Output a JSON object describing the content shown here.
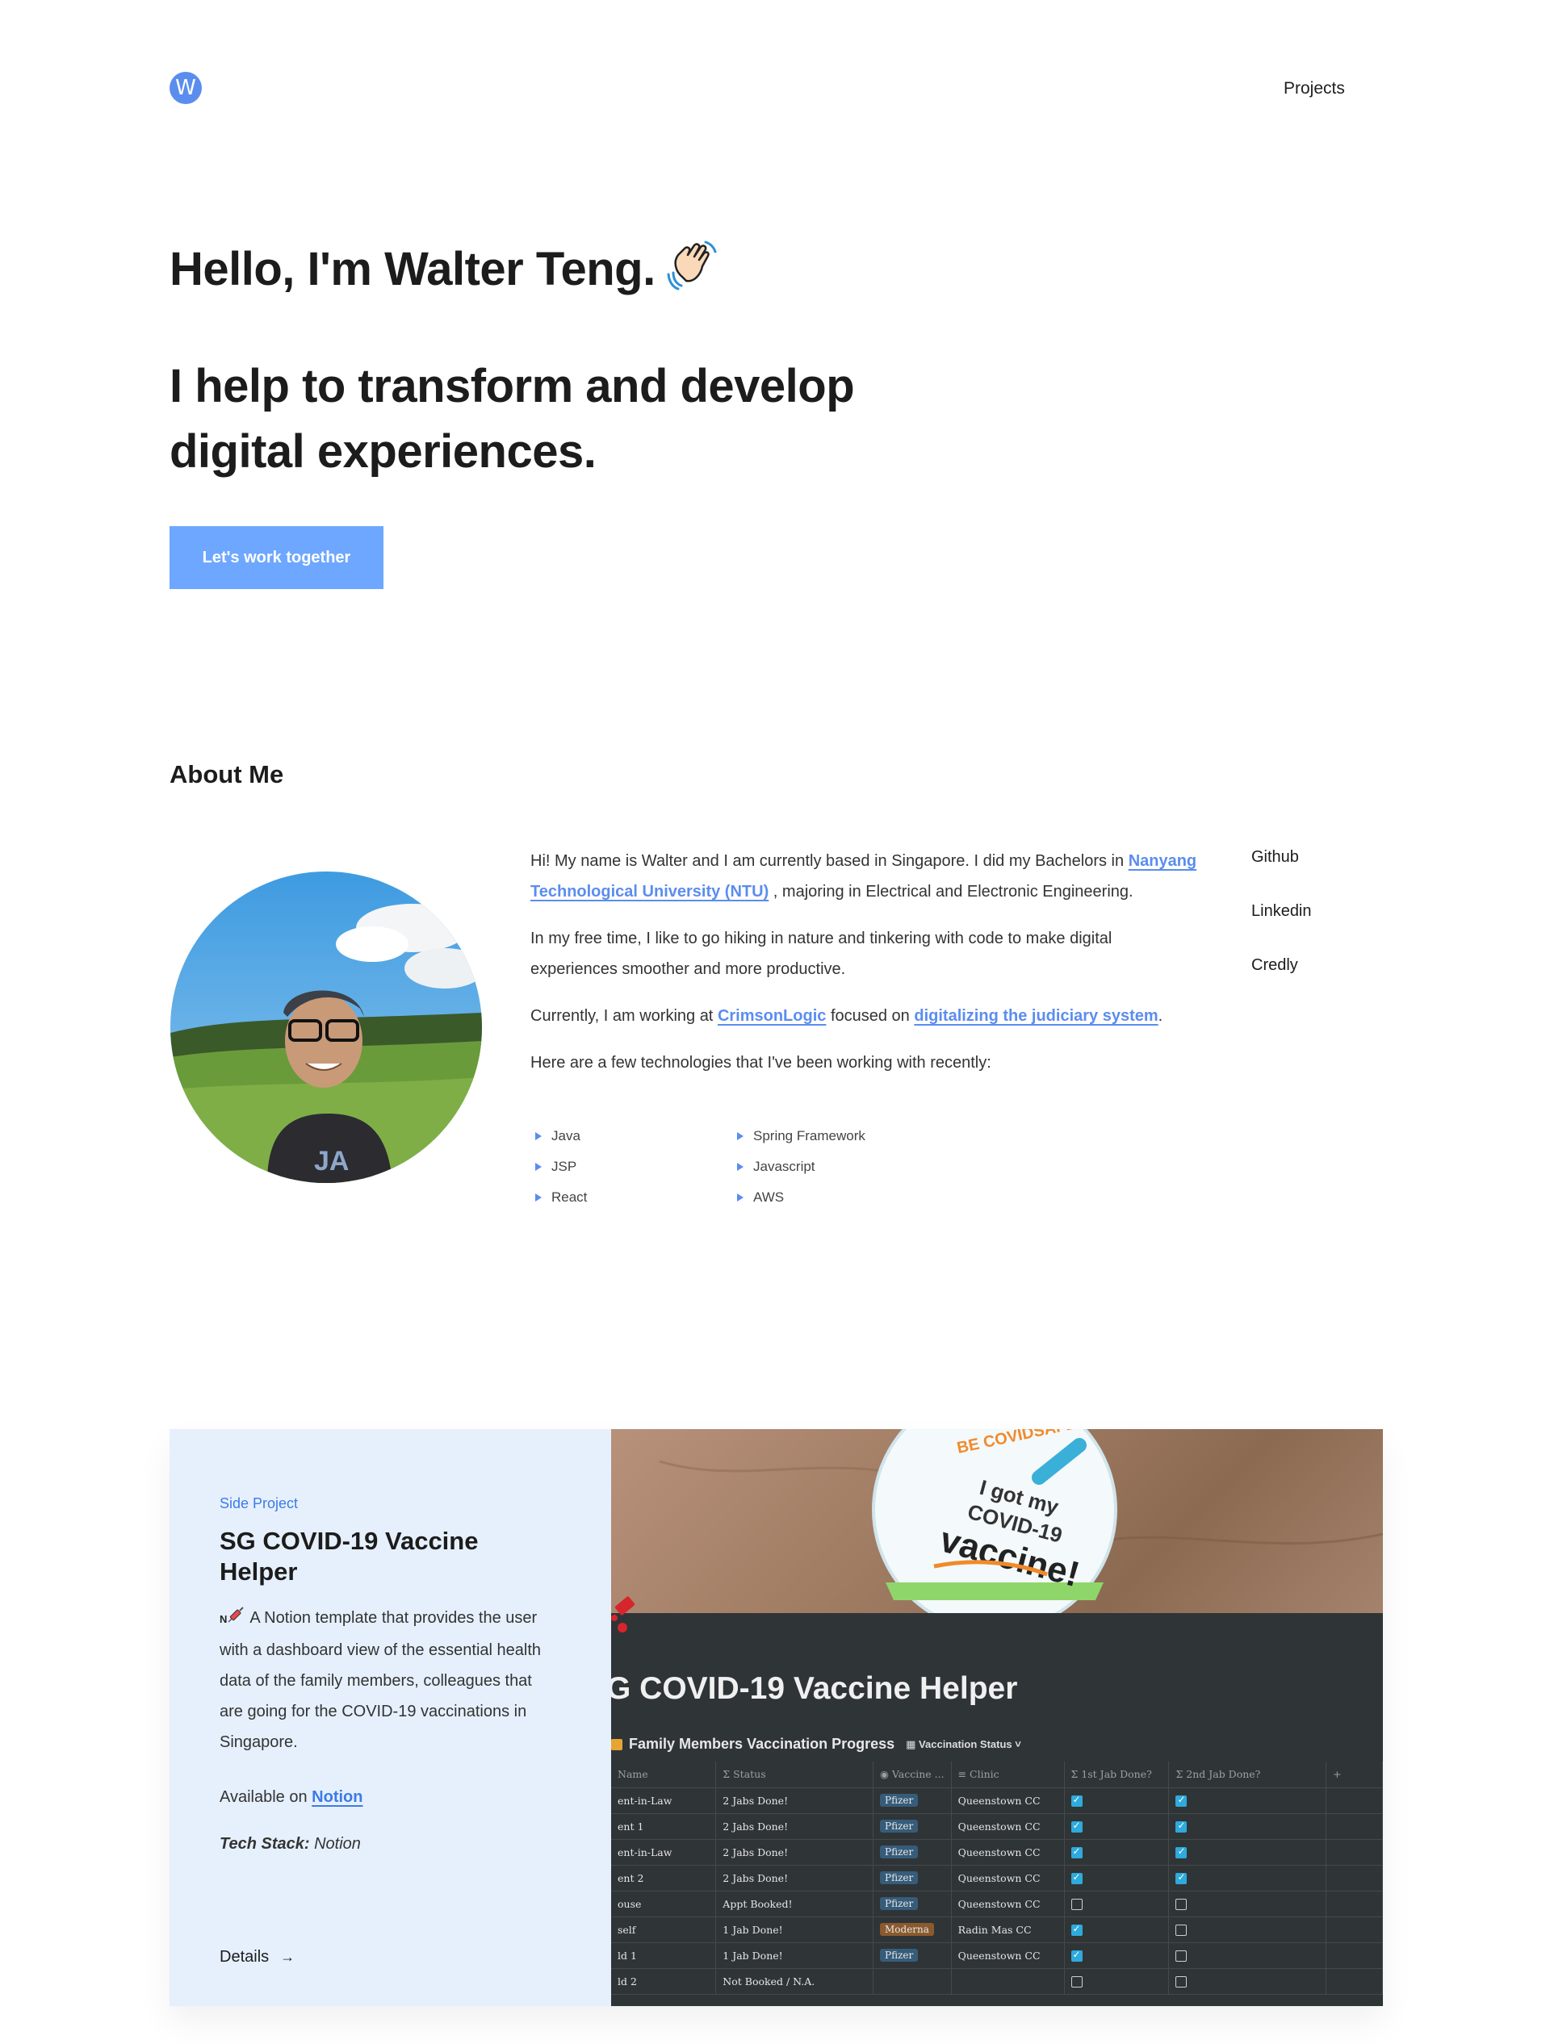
{
  "header": {
    "logo_letter": "W",
    "nav": {
      "projects": "Projects"
    }
  },
  "hero": {
    "title": "Hello, I'm Walter Teng.",
    "wave_icon": "waving-hand-emoji",
    "subtitle": "I help to transform and develop digital experiences.",
    "cta": "Let's work together"
  },
  "about": {
    "heading": "About Me",
    "p1_a": "Hi! My name is Walter and I am currently based in Singapore. I did my Bachelors in ",
    "p1_link": "Nanyang Technological University (NTU)",
    "p1_b": " , majoring in Electrical and Electronic Engineering.",
    "p2": "In my free time, I like to go hiking in nature and tinkering with code to make digital experiences smoother and more productive.",
    "p3_a": "Currently, I am working at ",
    "p3_link1": "CrimsonLogic",
    "p3_b": " focused on ",
    "p3_link2": "digitalizing the judiciary system",
    "p3_c": ".",
    "p4": "Here are a few technologies that I've been working with recently:",
    "tech": [
      "Java",
      "Spring Framework",
      "JSP",
      "Javascript",
      "React",
      "AWS"
    ],
    "socials": [
      "Github",
      "Linkedin",
      "Credly"
    ]
  },
  "project": {
    "label": "Side Project",
    "title": "SG COVID-19 Vaccine Helper",
    "desc_prefix": "N",
    "desc": "A Notion template that provides the user with a dashboard view of the essential health data of the family members, colleagues that are going for the COVID-19 vaccinations in Singapore.",
    "available_prefix": "Available on ",
    "available_link": "Notion",
    "stack_label": "Tech Stack:",
    "stack_value": " Notion",
    "details": "Details",
    "screenshot": {
      "badge_top": "BE COVIDSAFE",
      "badge_line1": "I got my",
      "badge_line2": "COVID-19",
      "badge_line3": "vaccine!",
      "page_title": "G COVID-19 Vaccine Helper",
      "db_title": "Family Members Vaccination Progress",
      "db_view": "Vaccination Status",
      "columns": [
        "Name",
        "Status",
        "Vaccine ...",
        "Clinic",
        "1st Jab Done?",
        "2nd Jab Done?",
        "+"
      ],
      "rows": [
        {
          "name": "ent-in-Law",
          "status": "2 Jabs Done!",
          "vaccine": "Pfizer",
          "clinic": "Queenstown CC",
          "jab1": true,
          "jab2": true
        },
        {
          "name": "ent 1",
          "status": "2 Jabs Done!",
          "vaccine": "Pfizer",
          "clinic": "Queenstown CC",
          "jab1": true,
          "jab2": true
        },
        {
          "name": "ent-in-Law",
          "status": "2 Jabs Done!",
          "vaccine": "Pfizer",
          "clinic": "Queenstown CC",
          "jab1": true,
          "jab2": true
        },
        {
          "name": "ent 2",
          "status": "2 Jabs Done!",
          "vaccine": "Pfizer",
          "clinic": "Queenstown CC",
          "jab1": true,
          "jab2": true
        },
        {
          "name": "ouse",
          "status": "Appt Booked!",
          "vaccine": "Pfizer",
          "clinic": "Queenstown CC",
          "jab1": false,
          "jab2": false
        },
        {
          "name": "self",
          "status": "1 Jab Done!",
          "vaccine": "Moderna",
          "clinic": "Radin Mas CC",
          "jab1": true,
          "jab2": false
        },
        {
          "name": "ld 1",
          "status": "1 Jab Done!",
          "vaccine": "Pfizer",
          "clinic": "Queenstown CC",
          "jab1": true,
          "jab2": false
        },
        {
          "name": "ld 2",
          "status": "Not Booked / N.A.",
          "vaccine": "",
          "clinic": "",
          "jab1": false,
          "jab2": false
        }
      ]
    }
  },
  "colors": {
    "accent": "#5b8def",
    "cta": "#6ea7ff",
    "card_bg": "#e6f0fd",
    "notion_dark": "#2f3437",
    "pfizer_tag": "#365c7a",
    "moderna_tag": "#8a5a2e"
  }
}
